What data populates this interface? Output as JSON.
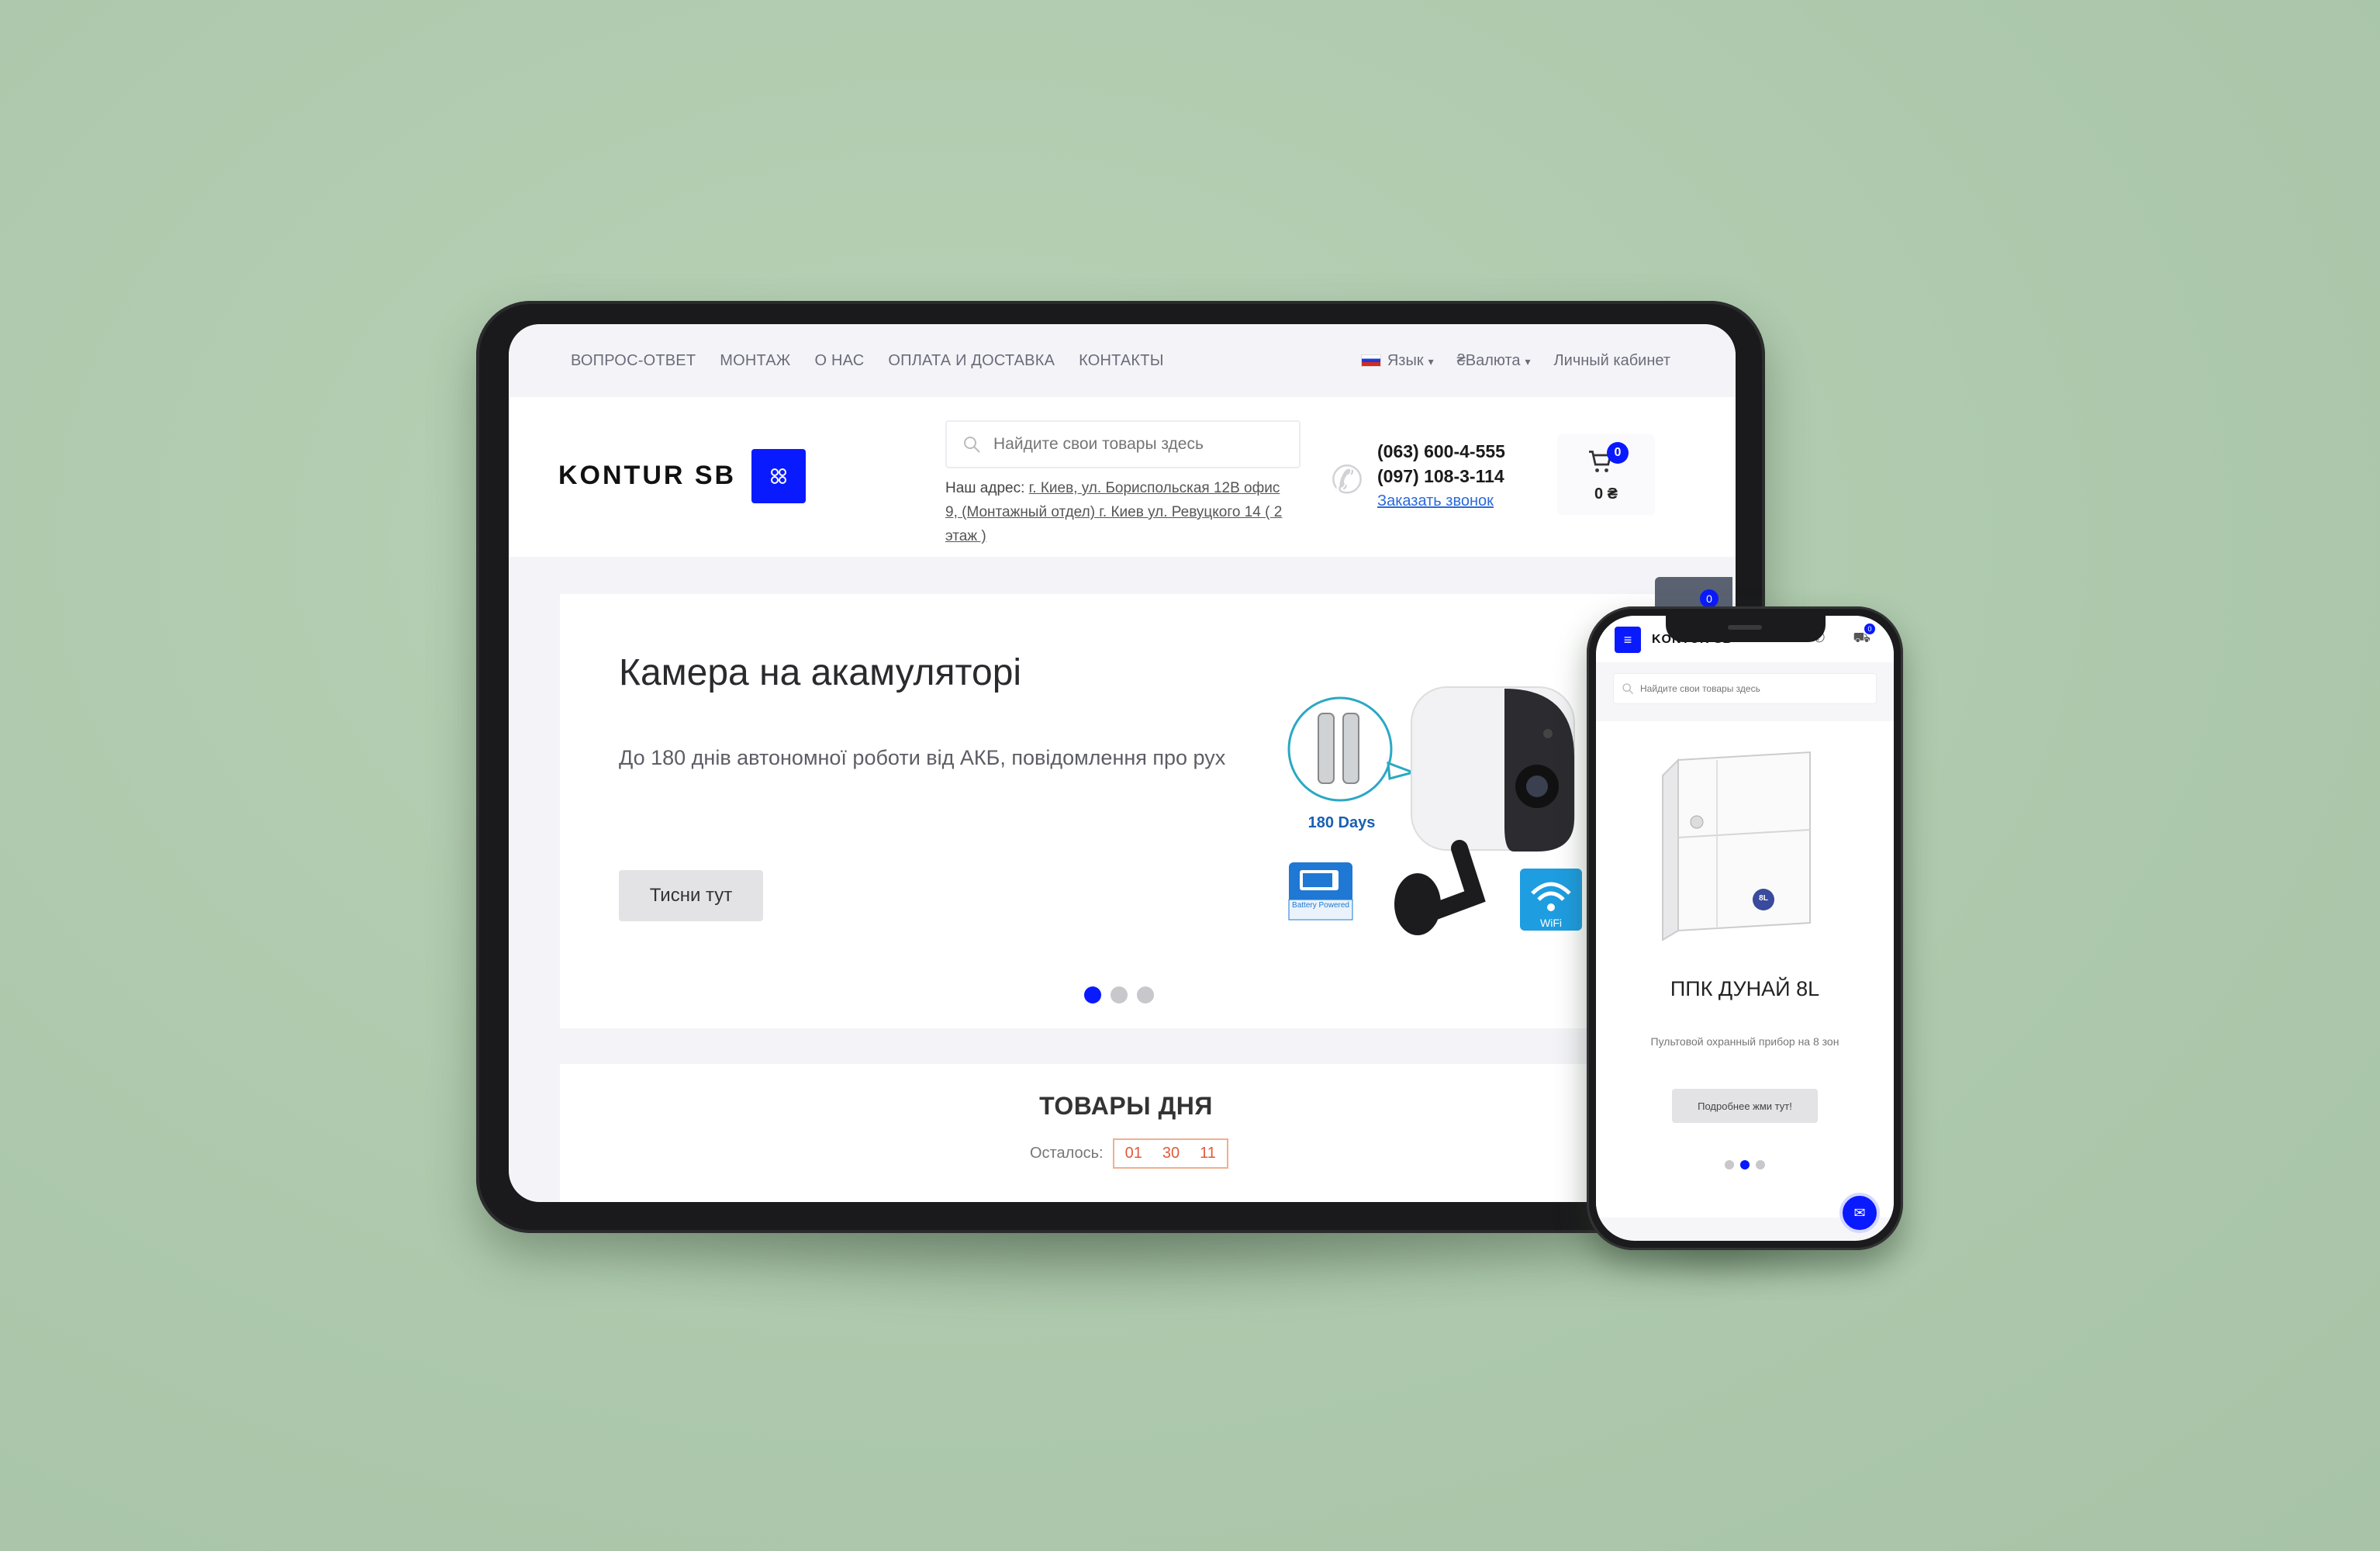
{
  "tablet": {
    "topnav": {
      "links": [
        "ВОПРОС-ОТВЕТ",
        "МОНТАЖ",
        "О НАС",
        "ОПЛАТА И ДОСТАВКА",
        "КОНТАКТЫ"
      ],
      "language": "Язык",
      "currency": "₴Валюта",
      "account": "Личный кабинет"
    },
    "header": {
      "logo": "KONTUR SB",
      "search_placeholder": "Найдите свои товары здесь",
      "address_label": "Наш адрес: ",
      "address_link": "г. Киев, ул. Бориспольская 12В офис 9, (Монтажный отдел) г. Киев ул. Ревуцкого 14 ( 2 этаж )",
      "phone1": "(063) 600-4-555",
      "phone2": "(097) 108-3-114",
      "callback": "Заказать звонок",
      "cart_count": "0",
      "cart_amount": "0 ₴"
    },
    "slider": {
      "title": "Камера на акамуляторі",
      "subtitle": "До 180 днів автономної роботи від АКБ, повідомлення про рух",
      "button": "Тисни тут",
      "active_slide": 1,
      "slides": 3,
      "image_text": {
        "days": "180 Days",
        "battery": "Battery Powered",
        "wifi": "WiFi"
      }
    },
    "deals": {
      "title": "ТОВАРЫ ДНЯ",
      "remaining_label": "Осталось:",
      "timer": [
        "01",
        "30",
        "11"
      ]
    },
    "side_widget_count": "0"
  },
  "phone": {
    "logo": "KONTUR SB",
    "cart_count": "0",
    "search_placeholder": "Найдите свои товары здесь",
    "product_title": "ППК ДУНАЙ 8L",
    "product_desc": "Пультовой охранный прибор на 8 зон",
    "button": "Подробнее жми тут!",
    "active_slide": 2,
    "slides": 3,
    "product_label": "8L"
  },
  "colors": {
    "background": "#b1ccb0",
    "accent": "#0a1aff",
    "timer": "#e05a3a"
  }
}
